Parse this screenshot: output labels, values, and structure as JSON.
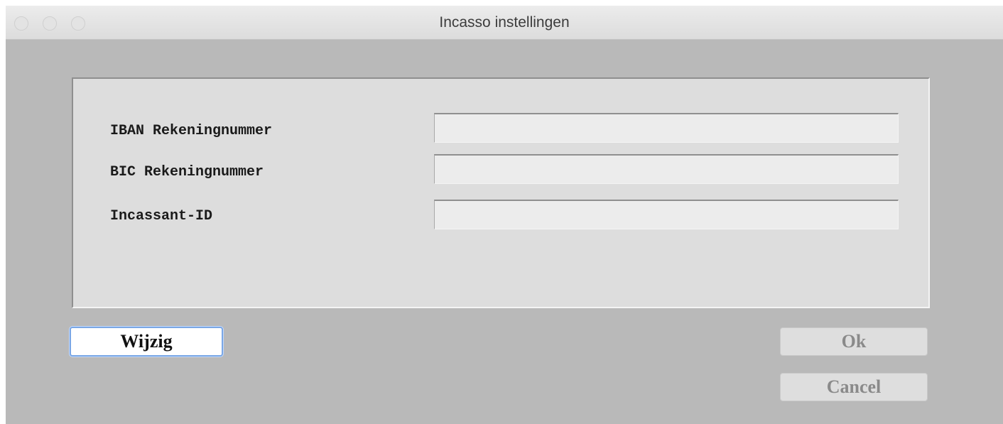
{
  "window": {
    "title": "Incasso instellingen"
  },
  "form": {
    "fields": [
      {
        "label": "IBAN Rekeningnummer",
        "value": ""
      },
      {
        "label": "BIC Rekeningnummer",
        "value": ""
      },
      {
        "label": "Incassant-ID",
        "value": ""
      }
    ]
  },
  "buttons": {
    "edit_label": "Wijzig",
    "ok_label": "Ok",
    "cancel_label": "Cancel"
  },
  "colors": {
    "window_background": "#b9b9b9",
    "panel_background": "#dddddd",
    "focus_ring": "#7aa7e6",
    "disabled_text": "#8a8a8a"
  }
}
